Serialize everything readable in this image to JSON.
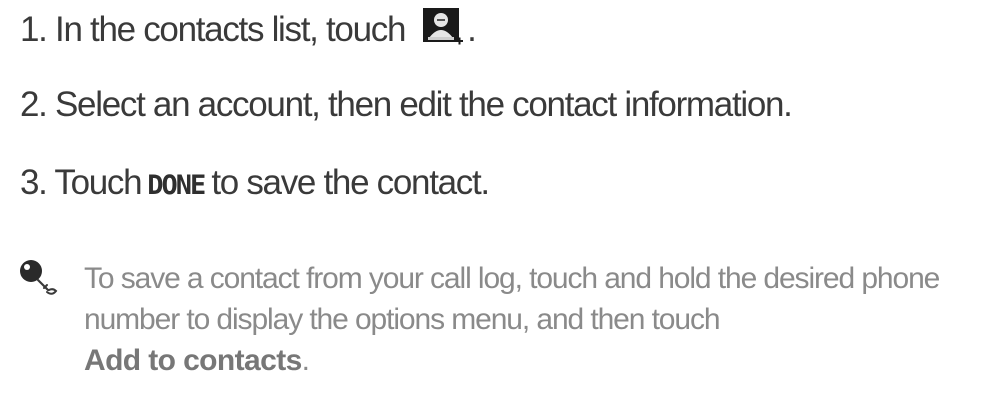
{
  "steps": {
    "step1_text": "1. In the contacts list, touch",
    "step1_end": ".",
    "step2_text": "2. Select an account, then edit the contact information.",
    "step3_before": "3. Touch",
    "step3_button": "DONE",
    "step3_after": "to save the contact."
  },
  "tip": {
    "text": "To save a contact from your call log, touch and hold the desired phone number to display the options menu, and then touch",
    "bold": "Add to contacts",
    "end": "."
  },
  "icons": {
    "add_contact": "add-contact-icon",
    "tip": "tip-key-icon"
  },
  "colors": {
    "step_text": "#3a3a3a",
    "tip_text": "#8a8a8a",
    "icon_bg": "#1a1a1a"
  }
}
